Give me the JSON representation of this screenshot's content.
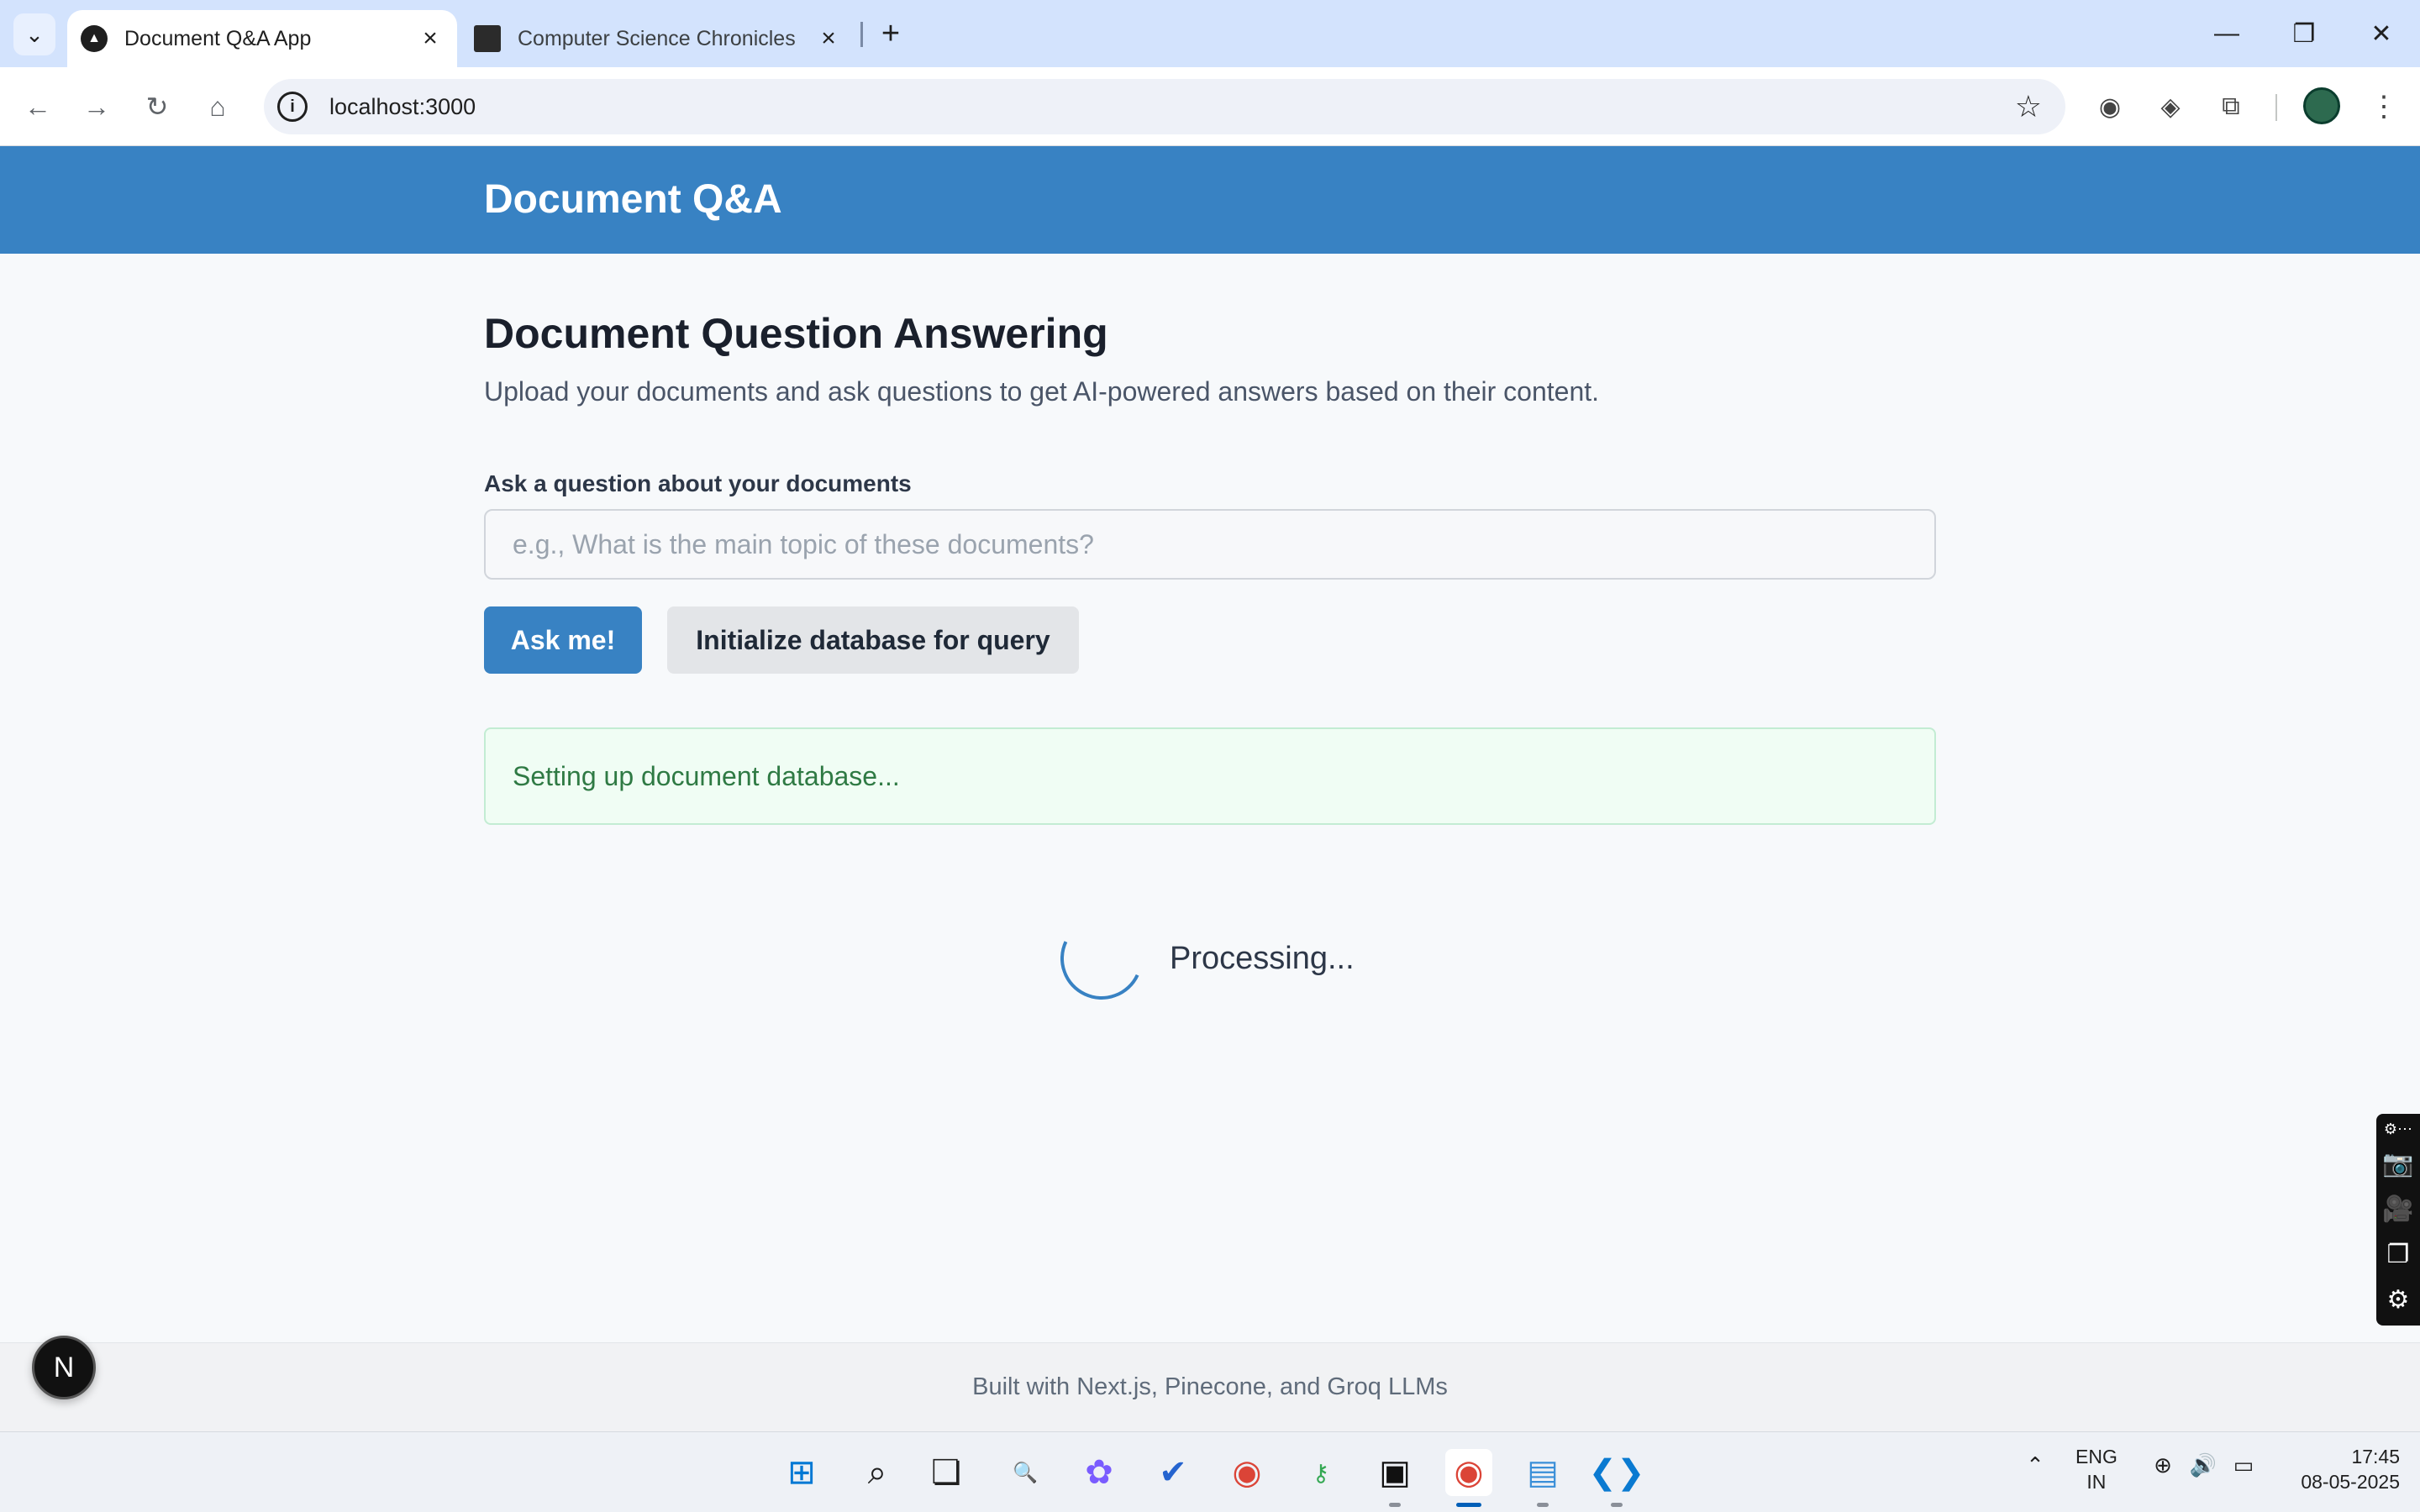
{
  "browser": {
    "tabs": [
      {
        "title": "Document Q&A App",
        "active": true,
        "favicon": "triangle-logo-icon"
      },
      {
        "title": "Computer Science Chronicles",
        "active": false,
        "favicon": "dark-thumbnail-icon"
      }
    ],
    "url": "localhost:3000"
  },
  "app": {
    "brand": "Document Q&A",
    "heading": "Document Question Answering",
    "subtitle": "Upload your documents and ask questions to get AI-powered answers based on their content.",
    "question_label": "Ask a question about your documents",
    "question_placeholder": "e.g., What is the main topic of these documents?",
    "question_value": "",
    "ask_button": "Ask me!",
    "init_button": "Initialize database for query",
    "status_message": "Setting up document database...",
    "processing_text": "Processing...",
    "footer": "Built with Next.js, Pinecone, and Groq LLMs",
    "next_badge": "N"
  },
  "taskbar": {
    "language": {
      "line1": "ENG",
      "line2": "IN"
    },
    "time": "17:45",
    "date": "08-05-2025"
  },
  "colors": {
    "primary": "#3882c3",
    "status_bg": "#f0fdf4",
    "status_text": "#2f7a44",
    "page_bg": "#f7f9fb"
  }
}
